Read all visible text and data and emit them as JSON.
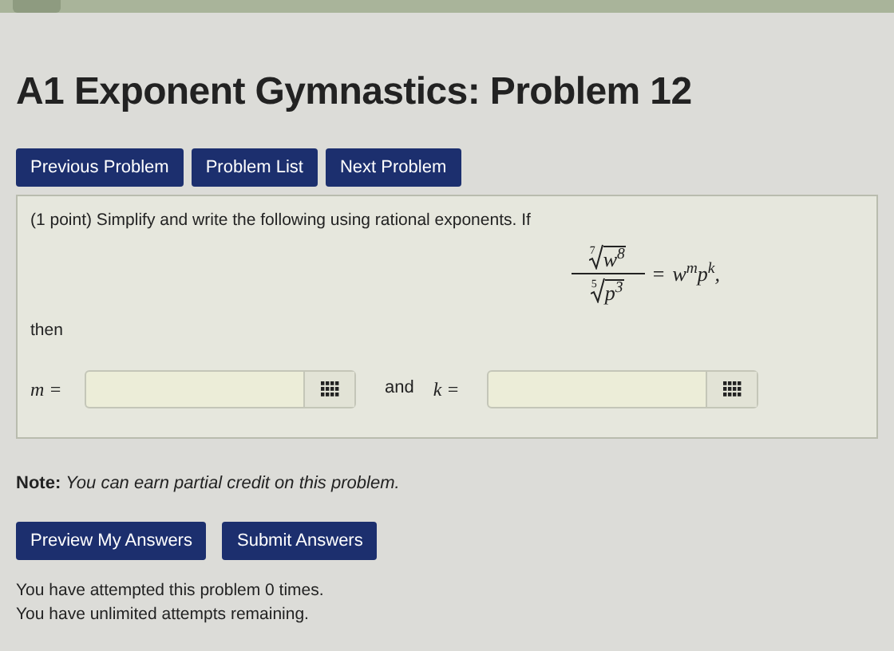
{
  "title": "A1 Exponent Gymnastics: Problem 12",
  "nav_buttons": [
    "Previous Problem",
    "Problem List",
    "Next Problem"
  ],
  "problem": {
    "intro": "(1 point) Simplify and write the following using rational exponents. If",
    "equation": {
      "numerator": {
        "index": "7",
        "base": "w",
        "exponent": "8"
      },
      "denominator": {
        "index": "5",
        "base": "p",
        "exponent": "3"
      },
      "equals": "=",
      "rhs": [
        {
          "base": "w",
          "exponent": "m"
        },
        {
          "base": "p",
          "exponent": "k"
        }
      ],
      "trailing": ","
    },
    "then": "then",
    "answers": [
      {
        "label": "m ="
      },
      {
        "label": "k =",
        "joiner": "and"
      }
    ]
  },
  "note": {
    "label": "Note:",
    "text": "You can earn partial credit on this problem."
  },
  "action_buttons": [
    "Preview My Answers",
    "Submit Answers"
  ],
  "messages": [
    "You have attempted this problem 0 times.",
    "You have unlimited attempts remaining."
  ]
}
